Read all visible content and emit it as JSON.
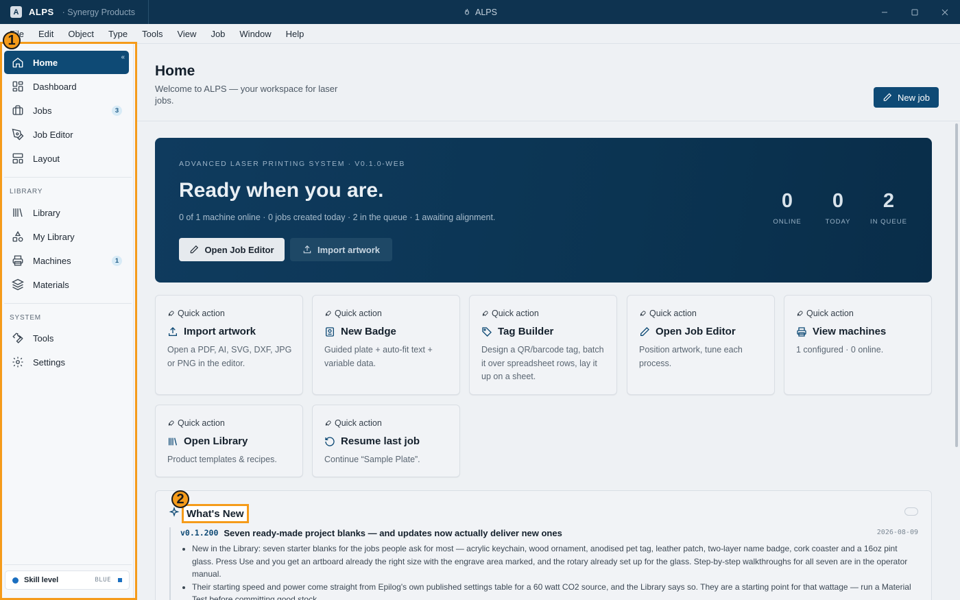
{
  "titlebar": {
    "logo_letter": "A",
    "app_name": "ALPS",
    "org": "· Synergy Products",
    "window_title": "ALPS"
  },
  "menu": [
    "File",
    "Edit",
    "Object",
    "Type",
    "Tools",
    "View",
    "Job",
    "Window",
    "Help"
  ],
  "sidebar": {
    "main_items": [
      {
        "label": "Home",
        "icon": "home-icon",
        "active": true
      },
      {
        "label": "Dashboard",
        "icon": "dashboard-icon"
      },
      {
        "label": "Jobs",
        "icon": "briefcase-icon",
        "count": "3"
      },
      {
        "label": "Job Editor",
        "icon": "pen-tool-icon"
      },
      {
        "label": "Layout",
        "icon": "layout-icon"
      }
    ],
    "library_label": "LIBRARY",
    "library_items": [
      {
        "label": "Library",
        "icon": "library-icon"
      },
      {
        "label": "My Library",
        "icon": "shapes-icon"
      },
      {
        "label": "Machines",
        "icon": "printer-icon",
        "count": "1"
      },
      {
        "label": "Materials",
        "icon": "layers-icon"
      }
    ],
    "system_label": "SYSTEM",
    "system_items": [
      {
        "label": "Tools",
        "icon": "wrench-icon"
      },
      {
        "label": "Settings",
        "icon": "gear-icon"
      }
    ],
    "skill": {
      "label": "Skill level",
      "value": "BLUE",
      "color": "#1b6fc0"
    }
  },
  "annotations": {
    "first": "1",
    "second": "2",
    "color": "#f59b1a"
  },
  "page": {
    "title": "Home",
    "subtitle": "Welcome to ALPS — your workspace for laser jobs.",
    "new_job_label": "New job"
  },
  "hero": {
    "eyebrow": "ADVANCED LASER PRINTING SYSTEM · V0.1.0-WEB",
    "title": "Ready when you are.",
    "subtitle": "0 of 1 machine online · 0 jobs created today · 2 in the queue · 1 awaiting alignment.",
    "btn_primary": "Open Job Editor",
    "btn_secondary": "Import artwork",
    "stats": [
      {
        "value": "0",
        "label": "ONLINE"
      },
      {
        "value": "0",
        "label": "TODAY"
      },
      {
        "value": "2",
        "label": "IN QUEUE"
      }
    ]
  },
  "quick_actions": [
    {
      "tag": "Quick action",
      "title": "Import artwork",
      "icon": "upload-icon",
      "desc": "Open a PDF, AI, SVG, DXF, JPG or PNG in the editor."
    },
    {
      "tag": "Quick action",
      "title": "New Badge",
      "icon": "badge-icon",
      "desc": "Guided plate + auto-fit text + variable data."
    },
    {
      "tag": "Quick action",
      "title": "Tag Builder",
      "icon": "tag-icon",
      "desc": "Design a QR/barcode tag, batch it over spreadsheet rows, lay it up on a sheet."
    },
    {
      "tag": "Quick action",
      "title": "Open Job Editor",
      "icon": "pencil-icon",
      "desc": "Position artwork, tune each process."
    },
    {
      "tag": "Quick action",
      "title": "View machines",
      "icon": "printer-icon",
      "desc": "1 configured · 0 online."
    },
    {
      "tag": "Quick action",
      "title": "Open Library",
      "icon": "library-icon",
      "desc": "Product templates & recipes."
    },
    {
      "tag": "Quick action",
      "title": "Resume last job",
      "icon": "history-icon",
      "desc": "Continue “Sample Plate”."
    }
  ],
  "whats_new": {
    "title": "What's New",
    "entry": {
      "version": "v0.1.200",
      "title": "Seven ready-made project blanks — and updates now actually deliver new ones",
      "date": "2026-08-09",
      "bullets": [
        "New in the Library: seven starter blanks for the jobs people ask for most — acrylic keychain, wood ornament, anodised pet tag, leather patch, two-layer name badge, cork coaster and a 16oz pint glass. Press Use and you get an artboard already the right size with the engrave area marked, and the rotary already set up for the glass. Step-by-step walkthroughs for all seven are in the operator manual.",
        "Their starting speed and power come straight from Epilog's own published settings table for a 60 watt CO2 source, and the Library says so. They are a starting point for that wattage — run a Material Test before committing good stock."
      ]
    }
  }
}
